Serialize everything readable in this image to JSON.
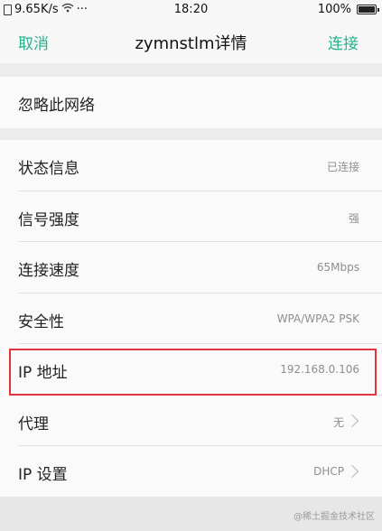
{
  "status_bar": {
    "net_speed": "9.65K/s",
    "dots": "···",
    "time": "18:20",
    "battery": "100%"
  },
  "nav": {
    "cancel": "取消",
    "title": "zymnstlm详情",
    "connect": "连接"
  },
  "actions": {
    "forget": "忽略此网络"
  },
  "details": [
    {
      "label": "状态信息",
      "value": "已连接"
    },
    {
      "label": "信号强度",
      "value": "强"
    },
    {
      "label": "连接速度",
      "value": "65Mbps"
    },
    {
      "label": "安全性",
      "value": "WPA/WPA2 PSK"
    },
    {
      "label": "IP 地址",
      "value": "192.168.0.106"
    },
    {
      "label": "代理",
      "value": "无"
    },
    {
      "label": "IP 设置",
      "value": "DHCP"
    }
  ],
  "highlight_color": "#e0363b",
  "accent_color": "#26b08e",
  "watermark": "@稀土掘金技术社区"
}
